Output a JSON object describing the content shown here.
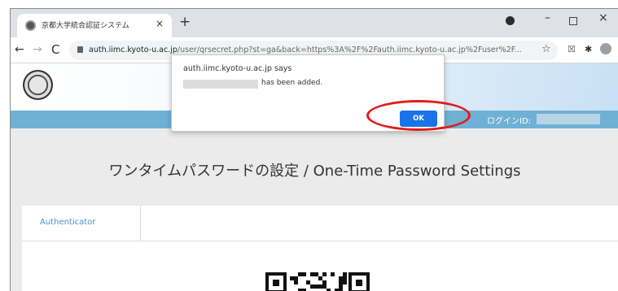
{
  "browser": {
    "tab_title": "京都大学統合認証システム",
    "tab_close": "×",
    "new_tab": "+",
    "url_host": "auth.iimc.kyoto-u.ac.jp",
    "url_path": "/user/qrsecret.php?st=ga&back=https%3A%2F%2Fauth.iimc.kyoto-u.ac.jp%2Fuser%2F...",
    "minimize": "–",
    "close": "×",
    "back": "←",
    "forward": "→",
    "reload": "C",
    "star": "☆",
    "kebab": "⋮",
    "icons": [
      "favicon-icon",
      "lock-icon",
      "star-icon",
      "extension-icon",
      "puzzle-icon",
      "profile-icon",
      "menu-icon"
    ]
  },
  "header": {
    "login_label": "ログインID:"
  },
  "main": {
    "heading": "ワンタイムパスワードの設定 / One-Time Password Settings",
    "tabs": [
      {
        "label": "Authenticator"
      }
    ]
  },
  "dialog": {
    "title": "auth.iimc.kyoto-u.ac.jp says",
    "message": "has been added.",
    "ok_label": "OK"
  },
  "colors": {
    "accent": "#1a73e8",
    "header_bar": "#6fb1d4",
    "highlight": "#e31b1b"
  }
}
